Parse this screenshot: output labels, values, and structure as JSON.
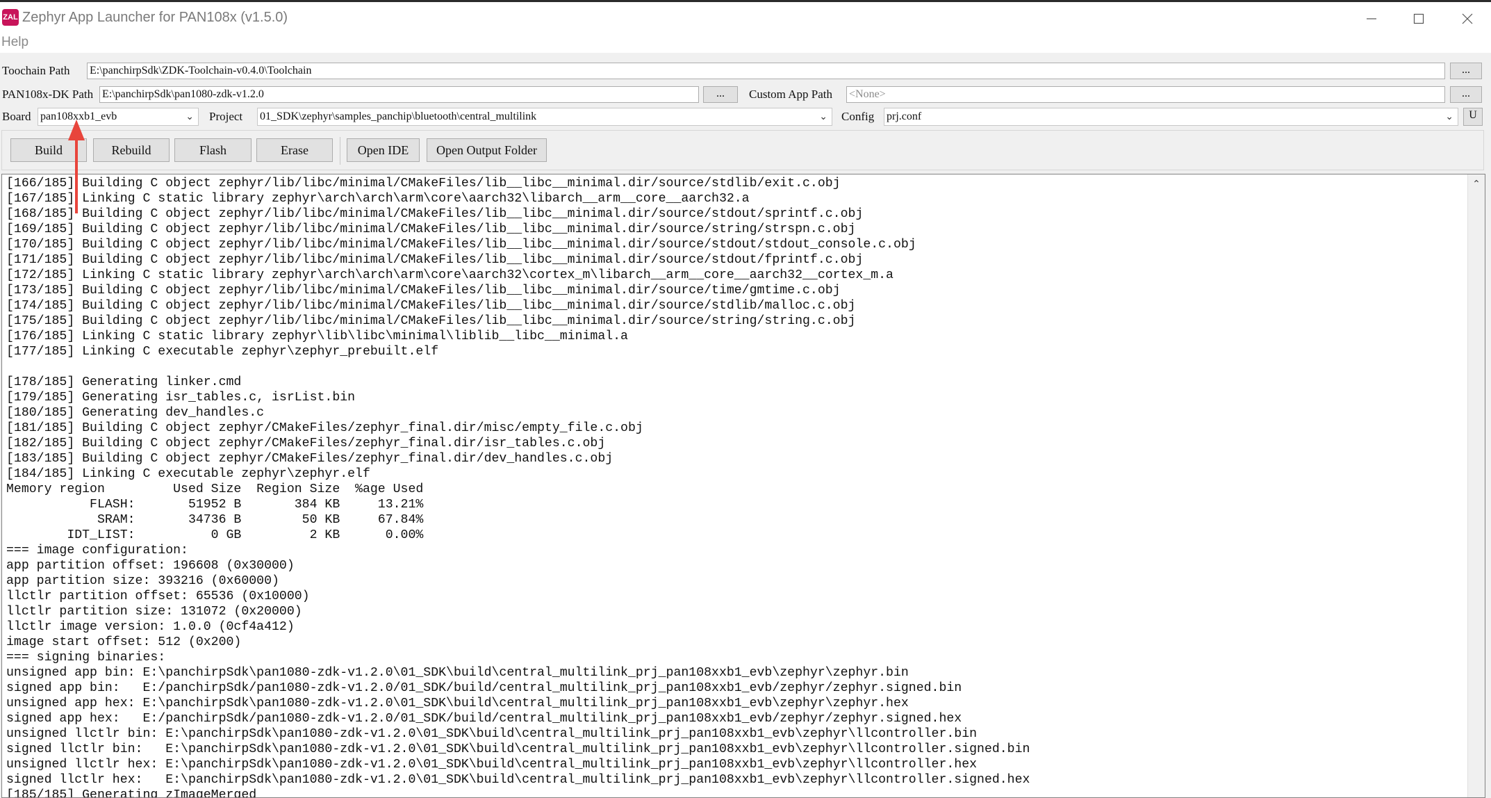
{
  "window": {
    "icon_text": "ZAL",
    "title": "Zephyr App Launcher for PAN108x (v1.5.0)"
  },
  "menu": {
    "help": "Help"
  },
  "toolchain": {
    "label": "Toochain Path",
    "value": "E:\\panchirpSdk\\ZDK-Toolchain-v0.4.0\\Toolchain",
    "browse": "..."
  },
  "dk": {
    "label": "PAN108x-DK Path",
    "value": "E:\\panchirpSdk\\pan1080-zdk-v1.2.0",
    "browse": "..."
  },
  "custom_app": {
    "label": "Custom App Path",
    "placeholder": "<None>",
    "browse": "..."
  },
  "board": {
    "label": "Board",
    "selected": "pan108xxb1_evb"
  },
  "project": {
    "label": "Project",
    "selected": "01_SDK\\zephyr\\samples_panchip\\bluetooth\\central_multilink"
  },
  "config": {
    "label": "Config",
    "selected": "prj.conf",
    "extra_button": "U"
  },
  "actions": {
    "build": "Build",
    "rebuild": "Rebuild",
    "flash": "Flash",
    "erase": "Erase",
    "open_ide": "Open IDE",
    "open_output": "Open Output Folder"
  },
  "output": {
    "lines": [
      "[166/185] Building C object zephyr/lib/libc/minimal/CMakeFiles/lib__libc__minimal.dir/source/stdlib/exit.c.obj",
      "[167/185] Linking C static library zephyr\\arch\\arch\\arm\\core\\aarch32\\libarch__arm__core__aarch32.a",
      "[168/185] Building C object zephyr/lib/libc/minimal/CMakeFiles/lib__libc__minimal.dir/source/stdout/sprintf.c.obj",
      "[169/185] Building C object zephyr/lib/libc/minimal/CMakeFiles/lib__libc__minimal.dir/source/string/strspn.c.obj",
      "[170/185] Building C object zephyr/lib/libc/minimal/CMakeFiles/lib__libc__minimal.dir/source/stdout/stdout_console.c.obj",
      "[171/185] Building C object zephyr/lib/libc/minimal/CMakeFiles/lib__libc__minimal.dir/source/stdout/fprintf.c.obj",
      "[172/185] Linking C static library zephyr\\arch\\arch\\arm\\core\\aarch32\\cortex_m\\libarch__arm__core__aarch32__cortex_m.a",
      "[173/185] Building C object zephyr/lib/libc/minimal/CMakeFiles/lib__libc__minimal.dir/source/time/gmtime.c.obj",
      "[174/185] Building C object zephyr/lib/libc/minimal/CMakeFiles/lib__libc__minimal.dir/source/stdlib/malloc.c.obj",
      "[175/185] Building C object zephyr/lib/libc/minimal/CMakeFiles/lib__libc__minimal.dir/source/string/string.c.obj",
      "[176/185] Linking C static library zephyr\\lib\\libc\\minimal\\liblib__libc__minimal.a",
      "[177/185] Linking C executable zephyr\\zephyr_prebuilt.elf",
      "",
      "[178/185] Generating linker.cmd",
      "[179/185] Generating isr_tables.c, isrList.bin",
      "[180/185] Generating dev_handles.c",
      "[181/185] Building C object zephyr/CMakeFiles/zephyr_final.dir/misc/empty_file.c.obj",
      "[182/185] Building C object zephyr/CMakeFiles/zephyr_final.dir/isr_tables.c.obj",
      "[183/185] Building C object zephyr/CMakeFiles/zephyr_final.dir/dev_handles.c.obj",
      "[184/185] Linking C executable zephyr\\zephyr.elf",
      "Memory region         Used Size  Region Size  %age Used",
      "           FLASH:       51952 B       384 KB     13.21%",
      "            SRAM:       34736 B        50 KB     67.84%",
      "        IDT_LIST:          0 GB         2 KB      0.00%",
      "=== image configuration:",
      "app partition offset: 196608 (0x30000)",
      "app partition size: 393216 (0x60000)",
      "llctlr partition offset: 65536 (0x10000)",
      "llctlr partition size: 131072 (0x20000)",
      "llctlr image version: 1.0.0 (0cf4a412)",
      "image start offset: 512 (0x200)",
      "=== signing binaries:",
      "unsigned app bin: E:\\panchirpSdk\\pan1080-zdk-v1.2.0\\01_SDK\\build\\central_multilink_prj_pan108xxb1_evb\\zephyr\\zephyr.bin",
      "signed app bin:   E:/panchirpSdk/pan1080-zdk-v1.2.0/01_SDK/build/central_multilink_prj_pan108xxb1_evb/zephyr/zephyr.signed.bin",
      "unsigned app hex: E:\\panchirpSdk\\pan1080-zdk-v1.2.0\\01_SDK\\build\\central_multilink_prj_pan108xxb1_evb\\zephyr\\zephyr.hex",
      "signed app hex:   E:/panchirpSdk/pan1080-zdk-v1.2.0/01_SDK/build/central_multilink_prj_pan108xxb1_evb/zephyr/zephyr.signed.hex",
      "unsigned llctlr bin: E:\\panchirpSdk\\pan1080-zdk-v1.2.0\\01_SDK\\build\\central_multilink_prj_pan108xxb1_evb\\zephyr\\llcontroller.bin",
      "signed llctlr bin:   E:\\panchirpSdk\\pan1080-zdk-v1.2.0\\01_SDK\\build\\central_multilink_prj_pan108xxb1_evb\\zephyr\\llcontroller.signed.bin",
      "unsigned llctlr hex: E:\\panchirpSdk\\pan1080-zdk-v1.2.0\\01_SDK\\build\\central_multilink_prj_pan108xxb1_evb\\zephyr\\llcontroller.hex",
      "signed llctlr hex:   E:\\panchirpSdk\\pan1080-zdk-v1.2.0\\01_SDK\\build\\central_multilink_prj_pan108xxb1_evb\\zephyr\\llcontroller.signed.hex",
      "[185/185] Generating zImageMerged"
    ]
  },
  "colors": {
    "icon_brand": "#c8145a",
    "annotation_arrow": "#e8453c"
  },
  "icons": {
    "minimize": "minimize-icon",
    "maximize": "maximize-icon",
    "close": "close-icon",
    "dropdown": "chevron-down-icon",
    "scroll_up": "scroll-up-icon"
  }
}
